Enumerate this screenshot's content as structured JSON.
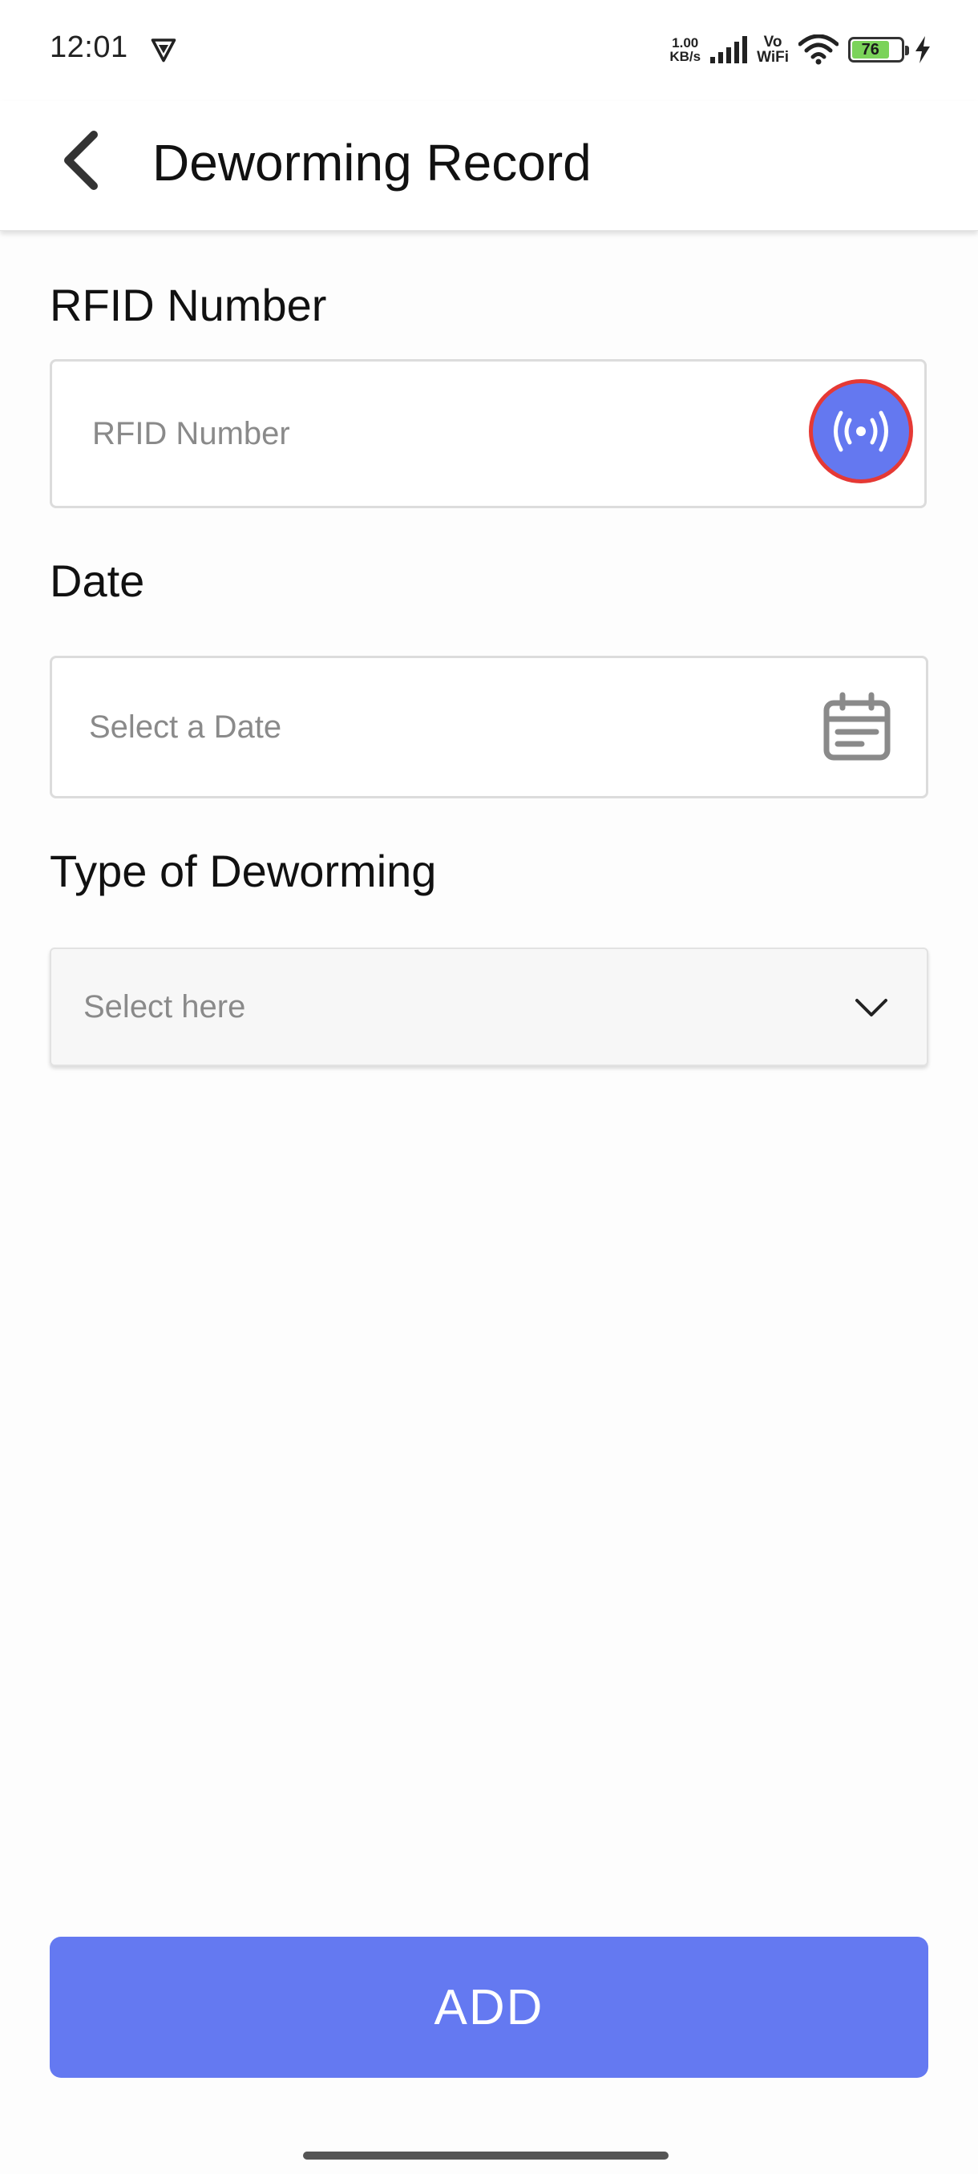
{
  "status_bar": {
    "time": "12:01",
    "net_speed_value": "1.00",
    "net_speed_unit": "KB/s",
    "vowifi_top": "Vo",
    "vowifi_bottom": "WiFi",
    "battery_level": "76",
    "battery_color": "#7bd35a"
  },
  "app_bar": {
    "back_icon": "chevron-left-icon",
    "title": "Deworming Record"
  },
  "form": {
    "rfid": {
      "label": "RFID Number",
      "value": "",
      "placeholder": "RFID Number",
      "scan_icon": "rfid-scan-icon"
    },
    "date": {
      "label": "Date",
      "value": "",
      "placeholder": "Select a Date",
      "icon": "calendar-icon"
    },
    "deworming_type": {
      "label": "Type of Deworming",
      "selected": "Select here",
      "icon": "chevron-down-icon"
    }
  },
  "actions": {
    "add_label": "ADD"
  },
  "colors": {
    "accent": "#6479f1",
    "scan_button_border": "#e53935"
  }
}
